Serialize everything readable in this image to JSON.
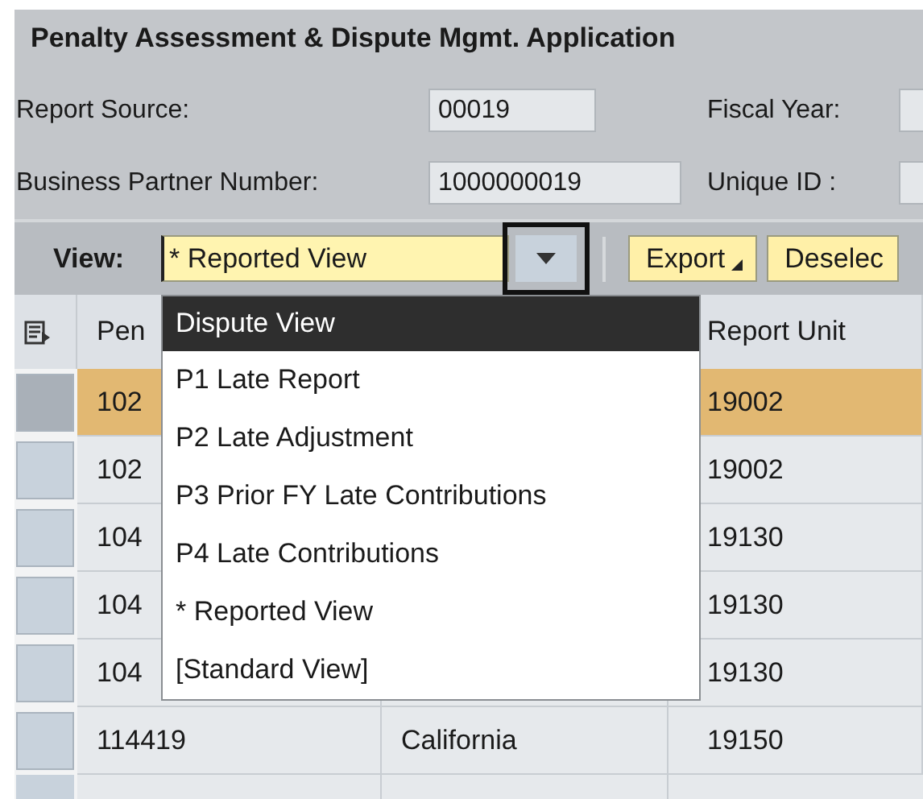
{
  "title": "Penalty Assessment & Dispute Mgmt. Application",
  "fields": [
    {
      "label": "Report Source:",
      "value": "00019"
    },
    {
      "label": "Fiscal Year:"
    },
    {
      "label": "Business Partner Number:",
      "value": "1000000019"
    },
    {
      "label": "Unique ID :"
    }
  ],
  "toolbar": {
    "view_label": "View:",
    "view_value": "* Reported View",
    "expanded": true,
    "buttons": [
      {
        "label": "Export",
        "menu": true
      },
      {
        "label": "Deselec",
        "menu": false
      }
    ]
  },
  "view_options": [
    {
      "label": "Dispute View",
      "selected": true
    },
    {
      "label": "P1 Late Report",
      "selected": false
    },
    {
      "label": "P2 Late Adjustment",
      "selected": false
    },
    {
      "label": "P3 Prior FY Late Contributions",
      "selected": false
    },
    {
      "label": "P4 Late Contributions",
      "selected": false
    },
    {
      "label": "* Reported View",
      "selected": false
    },
    {
      "label": "[Standard View]",
      "selected": false
    }
  ],
  "table": {
    "columns": {
      "column_1": "Pen",
      "column_3": "Report Unit"
    },
    "rows": [
      {
        "selected": true,
        "cells": {
          "column_1": "102",
          "column_3": "19002"
        }
      },
      {
        "selected": false,
        "cells": {
          "column_1": "102",
          "column_3": "19002"
        }
      },
      {
        "selected": false,
        "cells": {
          "column_1": "104",
          "column_3": "19130"
        }
      },
      {
        "selected": false,
        "cells": {
          "column_1": "104",
          "column_3": "19130"
        }
      },
      {
        "selected": false,
        "cells": {
          "column_1": "104",
          "column_3": "19130"
        }
      },
      {
        "selected": false,
        "cells": {
          "column_1": "114419",
          "column_2": "California",
          "column_3": "19150"
        }
      }
    ]
  }
}
